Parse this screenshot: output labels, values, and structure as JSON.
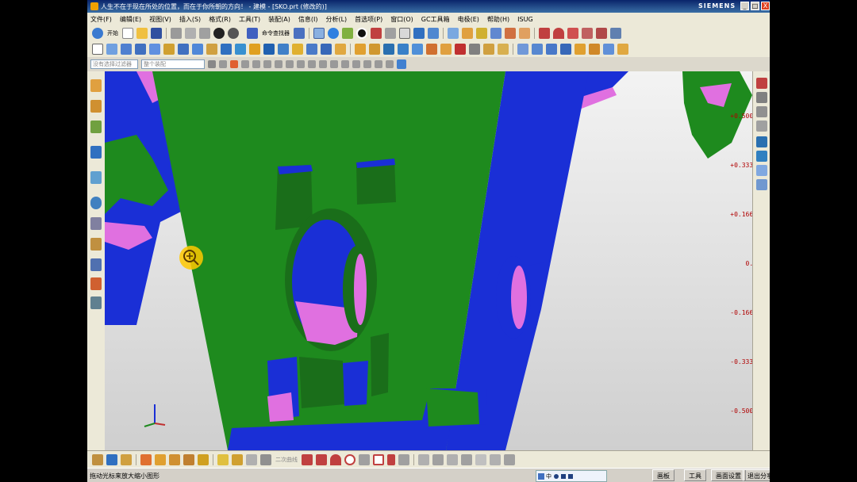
{
  "window": {
    "title": "人生不在于现在所处的位置，而在于你所朝的方向！ - 建模 - [SKO.prt (修改的)]",
    "brand": "SIEMENS",
    "controls": {
      "minimize": "_",
      "maximize": "□",
      "close": "X"
    }
  },
  "menubar": {
    "items": [
      "文件(F)",
      "编辑(E)",
      "视图(V)",
      "插入(S)",
      "格式(R)",
      "工具(T)",
      "装配(A)",
      "信息(I)",
      "分析(L)",
      "首选项(P)",
      "窗口(O)",
      "GC工具箱",
      "电极(E)",
      "帮助(H)",
      "ISUG"
    ]
  },
  "toolbar1": {
    "start_label": "开始",
    "command_finder_label": "命令查找器"
  },
  "toolbar3": {
    "filter_placeholder": "没有选择过滤器",
    "assembly_placeholder": "整个装配",
    "sketch_label": "二次曲线"
  },
  "legend": {
    "labels": [
      "+0.5000",
      "+0.3333",
      "+0.1667",
      "0.0",
      "-0.1667",
      "-0.3333",
      "-0.5000"
    ],
    "label_color": "#b00000"
  },
  "viewport": {
    "part_color": "#1e8a1e",
    "side_color": "#1a2fd6",
    "highlight_color": "#e070e0",
    "cursor_icon": "zoom-icon"
  },
  "statusbar": {
    "text": "拖动光标来放大缩小图形",
    "ime_label": "中",
    "buttons": [
      "画板",
      "工具",
      "画面设置",
      "退出分享"
    ]
  }
}
